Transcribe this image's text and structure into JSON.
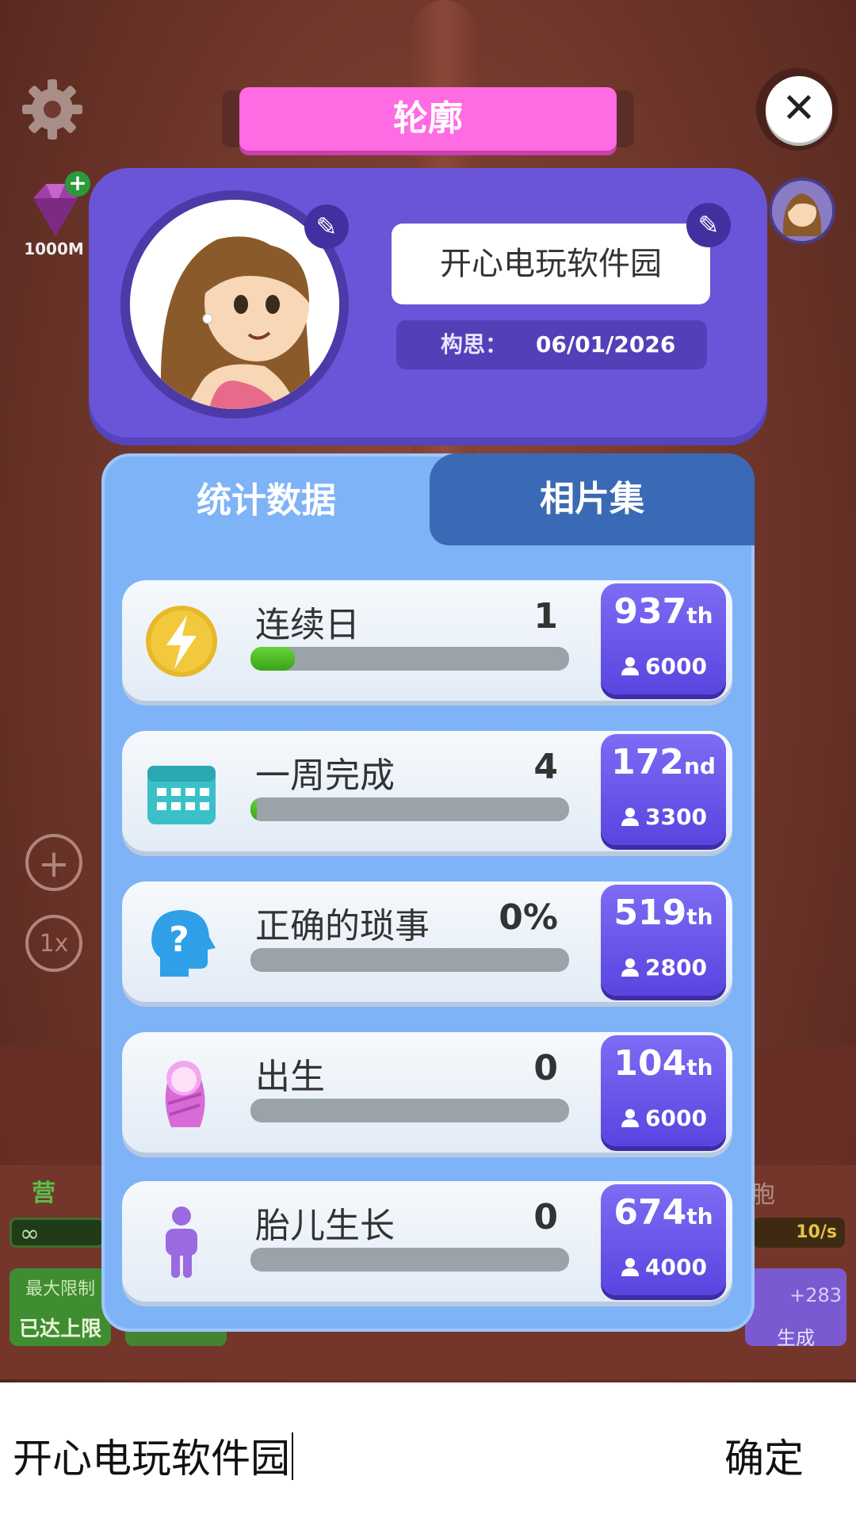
{
  "banner": {
    "title": "轮廓"
  },
  "hud": {
    "gem_amount": "1000M",
    "speed_label": "1x"
  },
  "profile": {
    "name": "开心电玩软件园",
    "date_label": "构思：",
    "date_value": "06/01/2026"
  },
  "tabs": [
    {
      "label": "统计数据",
      "active": true
    },
    {
      "label": "相片集",
      "active": false
    }
  ],
  "stats": [
    {
      "icon": "lightning-icon",
      "label": "连续日",
      "value": "1",
      "progress": 0.14,
      "rank": "937",
      "rank_suffix": "th",
      "players": "6000"
    },
    {
      "icon": "calendar-icon",
      "label": "一周完成",
      "value": "4",
      "progress": 0.02,
      "rank": "172",
      "rank_suffix": "nd",
      "players": "3300"
    },
    {
      "icon": "head-question-icon",
      "label": "正确的琐事",
      "value": "0%",
      "progress": 0,
      "rank": "519",
      "rank_suffix": "th",
      "players": "2800"
    },
    {
      "icon": "baby-icon",
      "label": "出生",
      "value": "0",
      "progress": 0,
      "rank": "104",
      "rank_suffix": "th",
      "players": "6000"
    },
    {
      "icon": "person-icon",
      "label": "胎儿生长",
      "value": "0",
      "progress": 0,
      "rank": "674",
      "rank_suffix": "th",
      "players": "4000"
    }
  ],
  "background": {
    "left_label": "营",
    "right_label": "胞",
    "left_bar": "∞",
    "right_bar": "10/s",
    "limit_label": "最大限制",
    "limit_reached": "已达上限",
    "gen_count": "+283",
    "gen_label": "生成"
  },
  "input": {
    "text": "开心电玩软件园",
    "confirm_label": "确定"
  },
  "colors": {
    "banner": "#ff6be3",
    "profile": "#6a55d8",
    "tab_inactive": "#3a6ab5",
    "rank_box": "#5a44e0",
    "progress": "#3aa317"
  }
}
